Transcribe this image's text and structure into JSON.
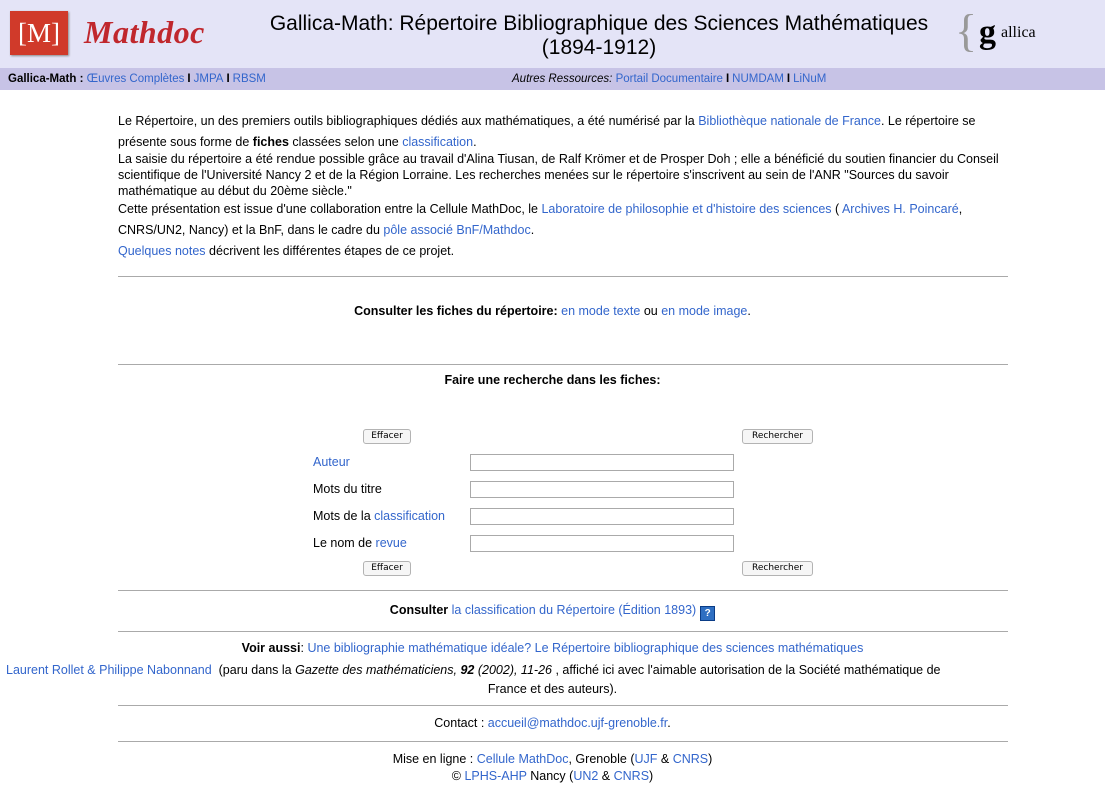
{
  "header": {
    "logo_m": "[M]",
    "logo_mathdoc": "Mathdoc",
    "title": "Gallica-Math: Répertoire Bibliographique des Sciences Mathématiques (1894-1912)",
    "gallica_g": "g",
    "gallica_rest": "allica"
  },
  "nav": {
    "label": "Gallica-Math :",
    "left_links": [
      "Œuvres Complètes",
      "JMPA",
      "RBSM"
    ],
    "right_label": "Autres Ressources:",
    "right_links": [
      "Portail Documentaire",
      "NUMDAM",
      "LiNuM"
    ],
    "separator": "I"
  },
  "intro": {
    "p1_a": "Le Répertoire, un des premiers outils bibliographiques dédiés aux mathématiques, a été numérisé par la ",
    "p1_link": "Bibliothèque nationale de France",
    "p1_b": ". Le répertoire se présente sous forme de ",
    "p1_bold": "fiches",
    "p1_c": " classées selon une ",
    "p1_link2": "classification",
    "p1_d": ".",
    "p2": "La saisie du répertoire a été rendue possible grâce au travail d'Alina Tiusan, de Ralf Krömer et de Prosper Doh ; elle a bénéficié du soutien financier du Conseil scientifique de l'Université Nancy 2 et de la Région Lorraine. Les recherches menées sur le répertoire s'inscrivent au sein de l'ANR \"Sources du savoir mathématique au début du 20ème siècle.\"",
    "p3_a": "Cette présentation est issue d'une collaboration entre la Cellule MathDoc, le ",
    "p3_link1": "Laboratoire de philosophie et d'histoire des sciences",
    "p3_b": " ( ",
    "p3_link2": "Archives H. Poincaré",
    "p3_c": ", CNRS/UN2, Nancy) et la BnF, dans le cadre du ",
    "p3_link3": "pôle associé BnF/Mathdoc",
    "p3_d": ".",
    "p4_link": "Quelques notes",
    "p4_text": " décrivent les différentes étapes de ce projet."
  },
  "consult": {
    "label": "Consulter les fiches du répertoire:",
    "link1": "en mode texte",
    "ou": " ou ",
    "link2": "en mode image",
    "end": "."
  },
  "search": {
    "heading": "Faire une recherche dans les fiches:",
    "clear_label": "Effacer",
    "search_label": "Rechercher",
    "author_label": "Auteur",
    "title_label": "Mots du titre",
    "class_label_a": "Mots de la ",
    "class_label_link": "classification",
    "journal_label_a": "Le nom de ",
    "journal_label_link": "revue",
    "author_value": "",
    "title_value": "",
    "class_value": "",
    "journal_value": ""
  },
  "classification": {
    "label": "Consulter",
    "link": "la classification du Répertoire (Édition 1893)",
    "help": "?"
  },
  "see_also": {
    "label": "Voir aussi",
    "link": "Une bibliographie mathématique idéale? Le Répertoire bibliographique des sciences mathématiques",
    "authors": "Laurent Rollet & Philippe Nabonnand",
    "t1": "  (paru dans la ",
    "journal": "Gazette des mathématiciens,",
    "vol": " 92",
    "pages": " (2002), 11-26",
    "t2": " , affiché ici avec l'aimable autorisation de la Société mathématique de",
    "t3": "France et des auteurs)."
  },
  "contact": {
    "label": "Contact : ",
    "email": "accueil@mathdoc.ujf-grenoble.fr",
    "end": "."
  },
  "footer": {
    "l1_a": "Mise en ligne : ",
    "l1_link": "Cellule MathDoc",
    "l1_b": ", Grenoble (",
    "l1_ujf": "UJF",
    "l1_amp": " & ",
    "l1_cnrs": "CNRS",
    "l1_end": ")",
    "l2_a": "© ",
    "l2_link": "LPHS-AHP",
    "l2_b": " Nancy (",
    "l2_un2": "UN2",
    "l2_amp": " & ",
    "l2_cnrs": "CNRS",
    "l2_end": ")"
  }
}
